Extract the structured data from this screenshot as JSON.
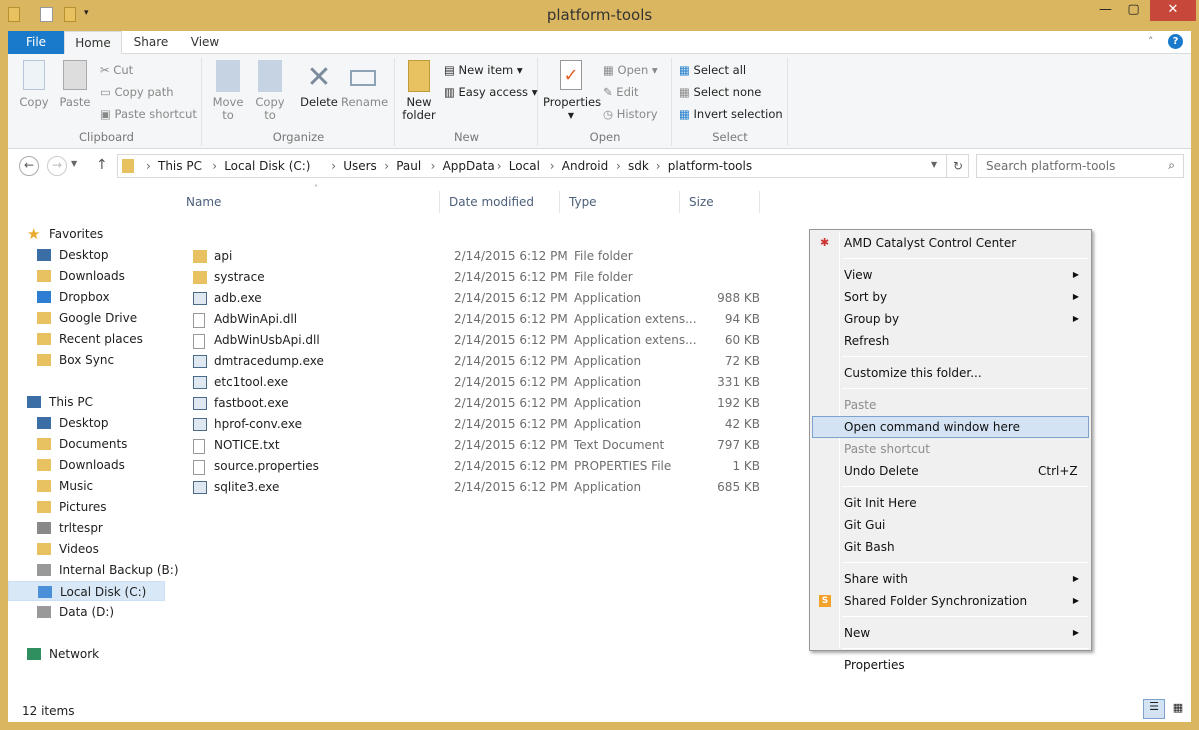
{
  "window": {
    "title": "platform-tools",
    "minimize": "—",
    "maximize": "▢",
    "close": "✕"
  },
  "tabs": {
    "file": "File",
    "home": "Home",
    "share": "Share",
    "view": "View",
    "help": "?"
  },
  "ribbon": {
    "clipboard": {
      "label": "Clipboard",
      "copy": "Copy",
      "paste": "Paste",
      "cut": "Cut",
      "copy_path": "Copy path",
      "paste_shortcut": "Paste shortcut"
    },
    "organize": {
      "label": "Organize",
      "move_to": "Move to",
      "copy_to": "Copy to",
      "delete": "Delete",
      "rename": "Rename"
    },
    "new": {
      "label": "New",
      "new_folder": "New folder",
      "new_item": "New item ▾",
      "easy_access": "Easy access ▾"
    },
    "open": {
      "label": "Open",
      "properties": "Properties",
      "open": "Open ▾",
      "edit": "Edit",
      "history": "History"
    },
    "select": {
      "label": "Select",
      "select_all": "Select all",
      "select_none": "Select none",
      "invert_selection": "Invert selection"
    }
  },
  "address": {
    "breadcrumb": [
      "This PC",
      "Local Disk (C:)",
      "Users",
      "Paul",
      "AppData",
      "Local",
      "Android",
      "sdk",
      "platform-tools"
    ],
    "search_placeholder": "Search platform-tools"
  },
  "nav": [
    {
      "label": "Favorites",
      "icon": "star-icon",
      "top": true
    },
    {
      "label": "Desktop",
      "icon": "desktop-icon"
    },
    {
      "label": "Downloads",
      "icon": "folder-icon"
    },
    {
      "label": "Dropbox",
      "icon": "dropbox-icon"
    },
    {
      "label": "Google Drive",
      "icon": "folder-icon"
    },
    {
      "label": "Recent places",
      "icon": "folder-icon"
    },
    {
      "label": "Box Sync",
      "icon": "folder-icon"
    },
    {
      "label": "",
      "gap": true
    },
    {
      "label": "This PC",
      "icon": "computer-icon",
      "top": true
    },
    {
      "label": "Desktop",
      "icon": "desktop-icon"
    },
    {
      "label": "Documents",
      "icon": "folder-icon"
    },
    {
      "label": "Downloads",
      "icon": "folder-icon"
    },
    {
      "label": "Music",
      "icon": "folder-icon"
    },
    {
      "label": "Pictures",
      "icon": "folder-icon"
    },
    {
      "label": "trltespr",
      "icon": "device-icon"
    },
    {
      "label": "Videos",
      "icon": "folder-icon"
    },
    {
      "label": "Internal Backup (B:)",
      "icon": "drive-icon"
    },
    {
      "label": "Local Disk (C:)",
      "icon": "windows-drive-icon",
      "selected": true
    },
    {
      "label": "Data (D:)",
      "icon": "drive-icon"
    },
    {
      "label": "",
      "gap": true
    },
    {
      "label": "Network",
      "icon": "network-icon",
      "top": true
    }
  ],
  "columns": {
    "name": "Name",
    "date": "Date modified",
    "type": "Type",
    "size": "Size"
  },
  "files": [
    {
      "name": "api",
      "date": "2/14/2015 6:12 PM",
      "type": "File folder",
      "size": "",
      "icon": "folder-icon"
    },
    {
      "name": "systrace",
      "date": "2/14/2015 6:12 PM",
      "type": "File folder",
      "size": "",
      "icon": "folder-icon"
    },
    {
      "name": "adb.exe",
      "date": "2/14/2015 6:12 PM",
      "type": "Application",
      "size": "988 KB",
      "icon": "exe-icon"
    },
    {
      "name": "AdbWinApi.dll",
      "date": "2/14/2015 6:12 PM",
      "type": "Application extens...",
      "size": "94 KB",
      "icon": "dll-icon"
    },
    {
      "name": "AdbWinUsbApi.dll",
      "date": "2/14/2015 6:12 PM",
      "type": "Application extens...",
      "size": "60 KB",
      "icon": "dll-icon"
    },
    {
      "name": "dmtracedump.exe",
      "date": "2/14/2015 6:12 PM",
      "type": "Application",
      "size": "72 KB",
      "icon": "exe-icon"
    },
    {
      "name": "etc1tool.exe",
      "date": "2/14/2015 6:12 PM",
      "type": "Application",
      "size": "331 KB",
      "icon": "exe-icon"
    },
    {
      "name": "fastboot.exe",
      "date": "2/14/2015 6:12 PM",
      "type": "Application",
      "size": "192 KB",
      "icon": "exe-icon"
    },
    {
      "name": "hprof-conv.exe",
      "date": "2/14/2015 6:12 PM",
      "type": "Application",
      "size": "42 KB",
      "icon": "exe-icon"
    },
    {
      "name": "NOTICE.txt",
      "date": "2/14/2015 6:12 PM",
      "type": "Text Document",
      "size": "797 KB",
      "icon": "text-file-icon"
    },
    {
      "name": "source.properties",
      "date": "2/14/2015 6:12 PM",
      "type": "PROPERTIES File",
      "size": "1 KB",
      "icon": "file-icon"
    },
    {
      "name": "sqlite3.exe",
      "date": "2/14/2015 6:12 PM",
      "type": "Application",
      "size": "685 KB",
      "icon": "exe-icon"
    }
  ],
  "status": {
    "items": "12 items"
  },
  "context_menu": [
    {
      "label": "AMD Catalyst Control Center",
      "icon": "amd-icon"
    },
    {
      "sep": true
    },
    {
      "label": "View",
      "submenu": true
    },
    {
      "label": "Sort by",
      "submenu": true
    },
    {
      "label": "Group by",
      "submenu": true
    },
    {
      "label": "Refresh"
    },
    {
      "sep": true
    },
    {
      "label": "Customize this folder..."
    },
    {
      "sep": true
    },
    {
      "label": "Paste",
      "disabled": true
    },
    {
      "label": "Open command window here",
      "highlighted": true
    },
    {
      "label": "Paste shortcut",
      "disabled": true
    },
    {
      "label": "Undo Delete",
      "shortcut": "Ctrl+Z"
    },
    {
      "sep": true
    },
    {
      "label": "Git Init Here"
    },
    {
      "label": "Git Gui"
    },
    {
      "label": "Git Bash"
    },
    {
      "sep": true
    },
    {
      "label": "Share with",
      "submenu": true
    },
    {
      "label": "Shared Folder Synchronization",
      "submenu": true,
      "icon": "sync-icon"
    },
    {
      "sep": true
    },
    {
      "label": "New",
      "submenu": true
    },
    {
      "sep": true
    },
    {
      "label": "Properties"
    }
  ],
  "colors": {
    "title_bar": "#dbb660",
    "file_tab": "#1979ca",
    "close": "#c7473b",
    "highlight": "#d3e3f4",
    "folder": "#e8c160"
  }
}
